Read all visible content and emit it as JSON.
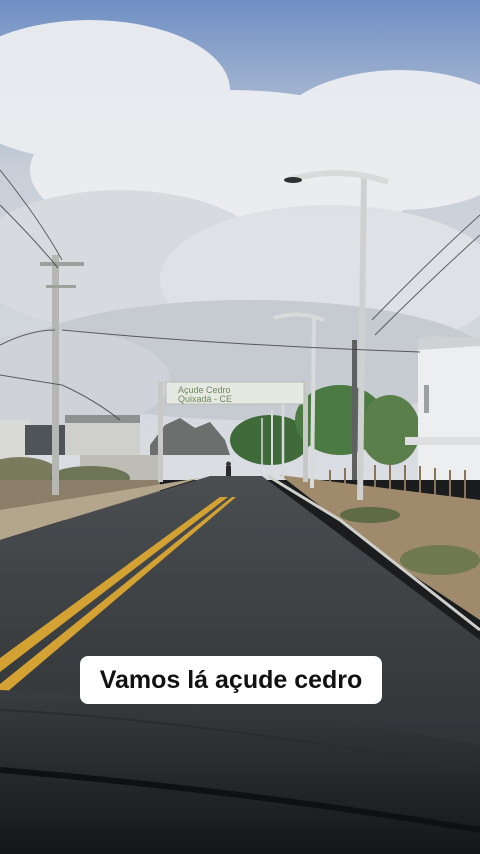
{
  "caption": {
    "text": "Vamos lá açude cedro"
  },
  "road_sign": {
    "line1": "Açude Cedro",
    "line2": "Quixadá - CE"
  },
  "colors": {
    "sky_blue": "#6f8fc4",
    "cloud": "#e9ebee",
    "asphalt": "#3d4144",
    "center_line": "#d4a233",
    "caption_background": "#ffffff",
    "caption_text": "#111111"
  }
}
